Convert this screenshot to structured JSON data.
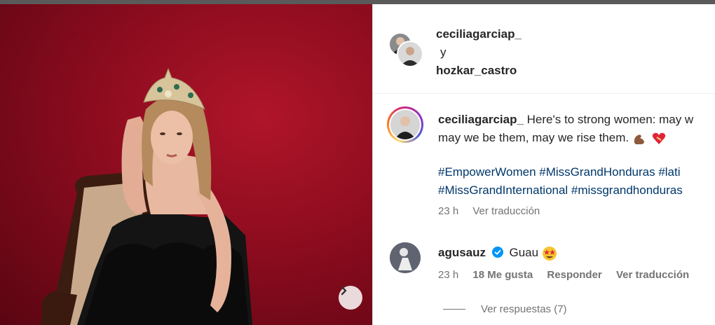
{
  "post": {
    "collaborators": {
      "user1": "ceciliagarciap_",
      "connector": "y",
      "user2": "hozkar_castro"
    },
    "caption": {
      "username": "ceciliagarciap_",
      "line1": "Here's to strong women: may w",
      "line2": "may we be them, may we rise them.",
      "hashtags_line1": "#EmpowerWomen #MissGrandHonduras #lati",
      "hashtags_line2": "#MissGrandInternational #missgrandhonduras",
      "time": "23 h",
      "translate": "Ver traducción"
    },
    "comments": [
      {
        "username": "agusauz",
        "text": "Guau",
        "time": "23 h",
        "likes": "18 Me gusta",
        "reply": "Responder",
        "translate": "Ver traducción",
        "view_replies": "Ver respuestas (7)"
      }
    ]
  },
  "icons": {
    "next": "chevron-right-icon",
    "verified": "verified-badge-icon",
    "flex": "flexed-biceps-emoji",
    "heart": "mending-heart-emoji",
    "star_eyes": "star-struck-emoji"
  },
  "colors": {
    "link": "#00376b",
    "muted": "#737373",
    "verified": "#0095f6",
    "photo_bg": "#8c0c1e"
  }
}
